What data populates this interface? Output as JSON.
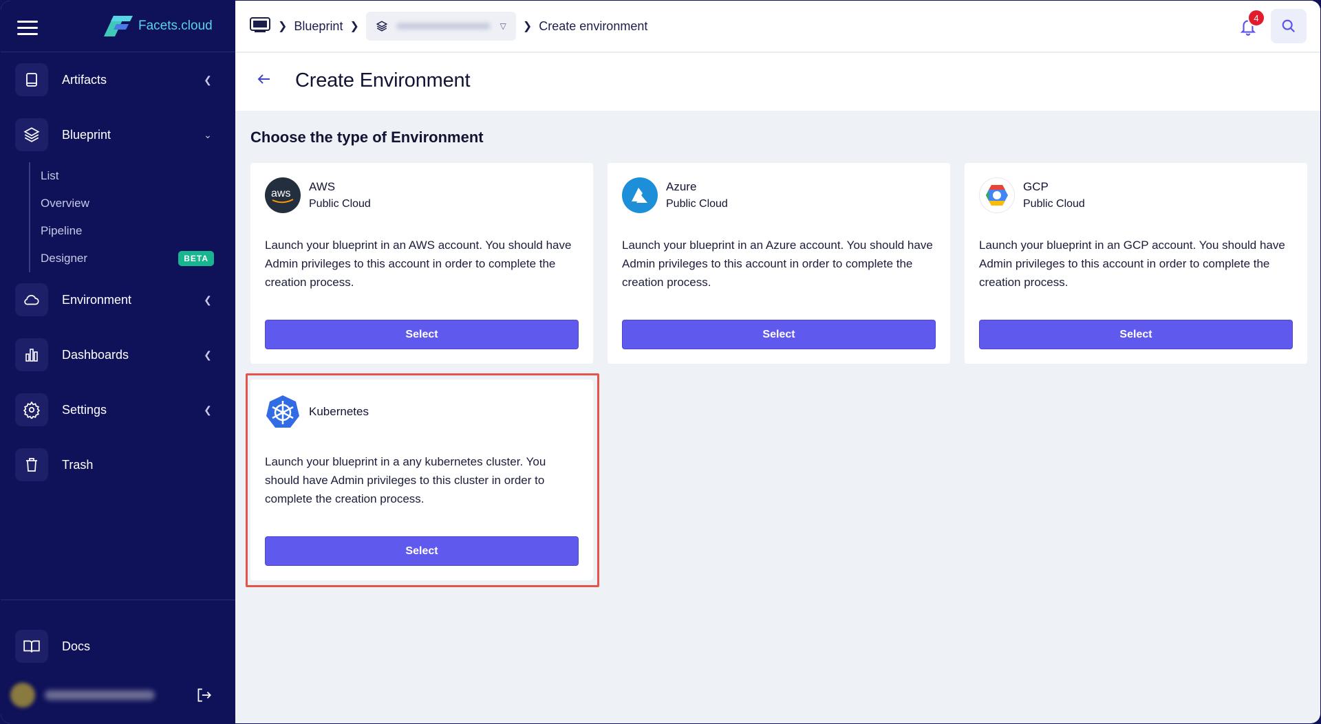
{
  "app": {
    "logo_text": "Facets.cloud"
  },
  "sidebar": {
    "items": [
      {
        "label": "Artifacts",
        "icon": "book-icon"
      },
      {
        "label": "Blueprint",
        "icon": "layers-icon"
      },
      {
        "label": "Environment",
        "icon": "cloud-icon"
      },
      {
        "label": "Dashboards",
        "icon": "bar-chart-icon"
      },
      {
        "label": "Settings",
        "icon": "gear-icon"
      },
      {
        "label": "Trash",
        "icon": "trash-icon"
      }
    ],
    "blueprint_sub": [
      {
        "label": "List"
      },
      {
        "label": "Overview"
      },
      {
        "label": "Pipeline"
      },
      {
        "label": "Designer",
        "badge": "BETA"
      }
    ],
    "docs": {
      "label": "Docs"
    }
  },
  "topbar": {
    "breadcrumb": {
      "home_icon": "demo-icon",
      "blueprint": "Blueprint",
      "current": "Create environment"
    },
    "notifications": {
      "count": "4"
    }
  },
  "page": {
    "title": "Create Environment",
    "section_title": "Choose the type of Environment"
  },
  "cards": [
    {
      "name": "AWS",
      "subtitle": "Public Cloud",
      "description": "Launch your blueprint in an AWS account. You should have Admin privileges to this account in order to complete the creation process.",
      "button": "Select"
    },
    {
      "name": "Azure",
      "subtitle": "Public Cloud",
      "description": "Launch your blueprint in an Azure account. You should have Admin privileges to this account in order to complete the creation process.",
      "button": "Select"
    },
    {
      "name": "GCP",
      "subtitle": "Public Cloud",
      "description": "Launch your blueprint in an GCP account. You should have Admin privileges to this account in order to complete the creation process.",
      "button": "Select"
    },
    {
      "name": "Kubernetes",
      "subtitle": "",
      "description": "Launch your blueprint in a any kubernetes cluster. You should have Admin privileges to this cluster in order to complete the creation process.",
      "button": "Select"
    }
  ],
  "colors": {
    "sidebar_bg": "#0f1159",
    "accent": "#6059ee",
    "highlight": "#e5544b",
    "badge": "#19b58f",
    "notification": "#e21b2d"
  }
}
